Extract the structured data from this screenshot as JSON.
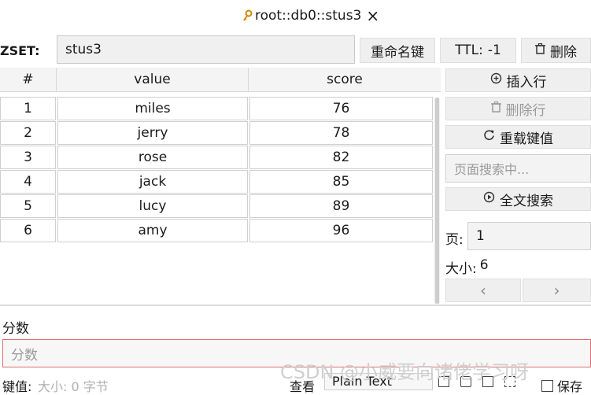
{
  "tab": {
    "title": "root::db0::stus3"
  },
  "form": {
    "type_label": "ZSET:",
    "key_name": "stus3",
    "rename_label": "重命名键",
    "ttl_label": "TTL:",
    "ttl_value": "-1",
    "delete_label": "删除"
  },
  "table": {
    "headers": [
      "#",
      "value",
      "score"
    ],
    "rows": [
      [
        "1",
        "miles",
        "76"
      ],
      [
        "2",
        "jerry",
        "78"
      ],
      [
        "3",
        "rose",
        "82"
      ],
      [
        "4",
        "jack",
        "85"
      ],
      [
        "5",
        "lucy",
        "89"
      ],
      [
        "6",
        "amy",
        "96"
      ]
    ]
  },
  "side": {
    "insert_label": "插入行",
    "delete_row_label": "删除行",
    "reload_label": "重载键值",
    "search_placeholder": "页面搜索中...",
    "fulltext_label": "全文搜索",
    "page_label": "页:",
    "page_value": "1",
    "size_label": "大小:",
    "size_value": "6",
    "prev": "‹",
    "next": "›"
  },
  "editor": {
    "field_label": "分数",
    "placeholder": "分数"
  },
  "footer": {
    "key_label": "键值:",
    "size_hint": "大小: 0 字节",
    "view_label": "查看",
    "view_mode": "Plain Text",
    "save_label": "保存"
  },
  "watermark": "CSDN @小威要向诸佬学习呀"
}
